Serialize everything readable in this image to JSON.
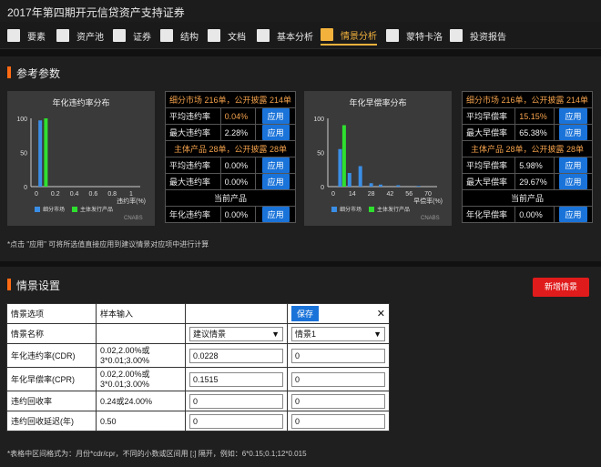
{
  "title": "2017年第四期开元信贷资产支持证券",
  "tabs": [
    {
      "label": "要素",
      "icon": "doc-icon"
    },
    {
      "label": "资产池",
      "icon": "chart-icon"
    },
    {
      "label": "证券",
      "icon": "list-icon"
    },
    {
      "label": "结构",
      "icon": "structure-icon"
    },
    {
      "label": "文档",
      "icon": "file-icon"
    },
    {
      "label": "基本分析",
      "icon": "table-icon"
    },
    {
      "label": "情景分析",
      "icon": "scenario-icon",
      "active": true
    },
    {
      "label": "蒙特卡洛",
      "icon": "m-icon"
    },
    {
      "label": "投资报告",
      "icon": "report-icon"
    }
  ],
  "params_section": {
    "title": "参考参数"
  },
  "cdr_chart": {
    "title": "年化违约率分布",
    "watermark": "CNABS",
    "axis_x_label": "违约率(%)",
    "legend": [
      "细分市场",
      "主体发行产品"
    ]
  },
  "cpr_chart": {
    "title": "年化早偿率分布",
    "watermark": "CNABS",
    "axis_x_label": "早偿率(%)",
    "legend": [
      "细分市场",
      "主体发行产品"
    ]
  },
  "chart_data": [
    {
      "type": "bar",
      "title": "年化违约率分布",
      "xlabel": "违约率(%)",
      "ylim": [
        0,
        100
      ],
      "yticks": [
        "0",
        "50",
        "100"
      ],
      "xticks": [
        "0",
        "0.2",
        "0.4",
        "0.6",
        "0.8",
        "1"
      ],
      "series": [
        {
          "name": "细分市场",
          "color": "#3a8ee6",
          "x": [
            0.04
          ],
          "values": [
            97
          ]
        },
        {
          "name": "主体发行产品",
          "color": "#2ee02e",
          "x": [
            0.1
          ],
          "values": [
            100
          ]
        }
      ]
    },
    {
      "type": "bar",
      "title": "年化早偿率分布",
      "xlabel": "早偿率(%)",
      "ylim": [
        0,
        100
      ],
      "yticks": [
        "0",
        "50",
        "100"
      ],
      "xticks": [
        "0",
        "14",
        "28",
        "42",
        "56",
        "70"
      ],
      "series": [
        {
          "name": "细分市场",
          "color": "#3a8ee6",
          "x": [
            5,
            12,
            20,
            28,
            35,
            48,
            63
          ],
          "values": [
            55,
            20,
            30,
            5,
            3,
            2,
            1
          ]
        },
        {
          "name": "主体发行产品",
          "color": "#2ee02e",
          "x": [
            8
          ],
          "values": [
            90
          ]
        }
      ]
    }
  ],
  "cdr_table": {
    "market_header": "细分市场 216单，公开披露 214单",
    "avg_label": "平均违约率",
    "avg_value": "0.04%",
    "max_label": "最大违约率",
    "max_value": "2.28%",
    "issuer_header": "主体产品 28单，公开披露 28单",
    "issuer_avg_label": "平均违约率",
    "issuer_avg_value": "0.00%",
    "issuer_max_label": "最大违约率",
    "issuer_max_value": "0.00%",
    "current_header": "当前产品",
    "current_label": "年化违约率",
    "current_value": "0.00%",
    "apply_label": "应用"
  },
  "cpr_table": {
    "market_header": "细分市场 216单，公开披露 214单",
    "avg_label": "平均早偿率",
    "avg_value": "15.15%",
    "max_label": "最大早偿率",
    "max_value": "65.38%",
    "issuer_header": "主体产品 28单，公开披露 28单",
    "issuer_avg_label": "平均早偿率",
    "issuer_avg_value": "5.98%",
    "issuer_max_label": "最大早偿率",
    "issuer_max_value": "29.67%",
    "current_header": "当前产品",
    "current_label": "年化早偿率",
    "current_value": "0.00%",
    "apply_label": "应用"
  },
  "params_note": "*点击 \"应用\" 可将所选值直接应用到建议情景对应项中进行计算",
  "scenario_section": {
    "title": "情景设置",
    "new_button": "新增情景"
  },
  "scenario_table": {
    "col_option": "情景选项",
    "col_sample": "样本输入",
    "save_label": "保存",
    "close_label": "✕",
    "rows": [
      {
        "label": "情景名称",
        "sample": "",
        "select1": "建议情景",
        "select2": "情景1"
      },
      {
        "label": "年化违约率(CDR)",
        "sample": "0.02,2.00%或\n3*0.01;3.00%",
        "value1": "0.0228",
        "value2": "0"
      },
      {
        "label": "年化早偿率(CPR)",
        "sample": "0.02,2.00%或\n3*0.01;3.00%",
        "value1": "0.1515",
        "value2": "0"
      },
      {
        "label": "违约回收率",
        "sample": "0.24或24.00%",
        "value1": "0",
        "value2": "0"
      },
      {
        "label": "违约回收延迟(年)",
        "sample": "0.50",
        "value1": "0",
        "value2": "0"
      }
    ]
  },
  "scenario_note": "*表格中区间格式为：月份*cdr/cpr，不同的小数或区间用 [;] 隔开，例如：6*0.15;0.1;12*0.015"
}
